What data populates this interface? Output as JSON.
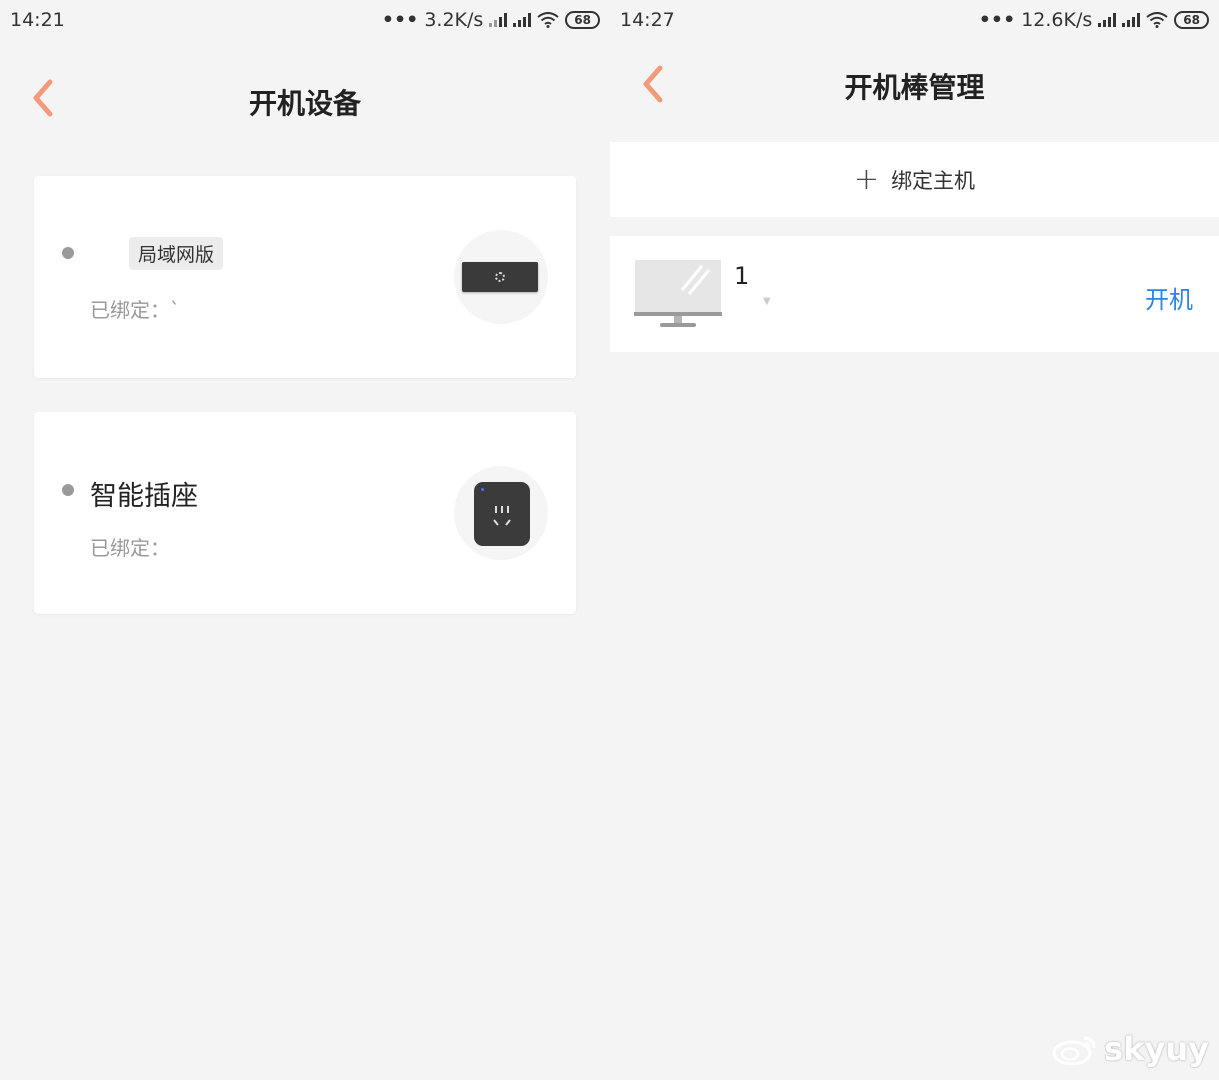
{
  "left": {
    "status": {
      "time": "14:21",
      "speed": "3.2K/s",
      "battery": "68"
    },
    "title": "开机设备",
    "cards": [
      {
        "name": "",
        "tag": "局域网版",
        "bound": "已绑定：`"
      },
      {
        "name": "智能插座",
        "bound": "已绑定："
      }
    ]
  },
  "right": {
    "status": {
      "time": "14:27",
      "speed": "12.6K/s",
      "battery": "68"
    },
    "title": "开机棒管理",
    "add_label": "绑定主机",
    "host": {
      "name": "1",
      "action": "开机"
    }
  },
  "watermark": "skyuy",
  "colors": {
    "accent_back": "#f39a7c",
    "link_blue": "#2a86e0",
    "background": "#f4f4f4"
  }
}
